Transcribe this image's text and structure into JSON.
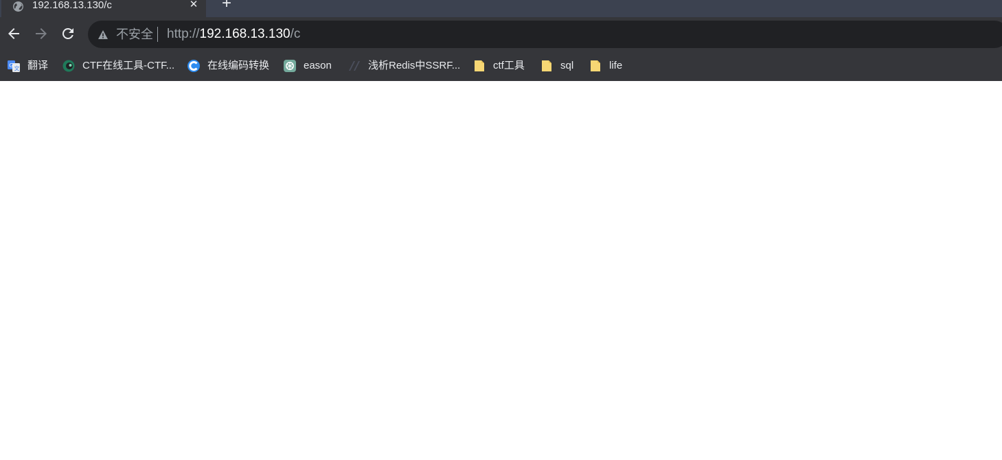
{
  "tab": {
    "title": "192.168.13.130/c",
    "favicon": "globe-icon",
    "close": "✕"
  },
  "new_tab": "+",
  "toolbar": {
    "insecure_label": "不安全",
    "url_scheme": "http://",
    "url_host": "192.168.13.130",
    "url_path": "/c"
  },
  "bookmarks": [
    {
      "label": "翻译",
      "icon": "google-translate-icon"
    },
    {
      "label": "CTF在线工具-CTF...",
      "icon": "ctf-tools-icon"
    },
    {
      "label": "在线编码转换",
      "icon": "encode-convert-icon"
    },
    {
      "label": "eason",
      "icon": "openai-icon"
    },
    {
      "label": "浅析Redis中SSRF...",
      "icon": "blog-icon"
    },
    {
      "label": "ctf工具",
      "icon": "folder-icon"
    },
    {
      "label": "sql",
      "icon": "folder-icon"
    },
    {
      "label": "life",
      "icon": "folder-icon"
    }
  ],
  "colors": {
    "tabstrip": "#3c4250",
    "toolbar": "#35363a",
    "omnibox": "#202124",
    "folder": "#f7d774"
  }
}
